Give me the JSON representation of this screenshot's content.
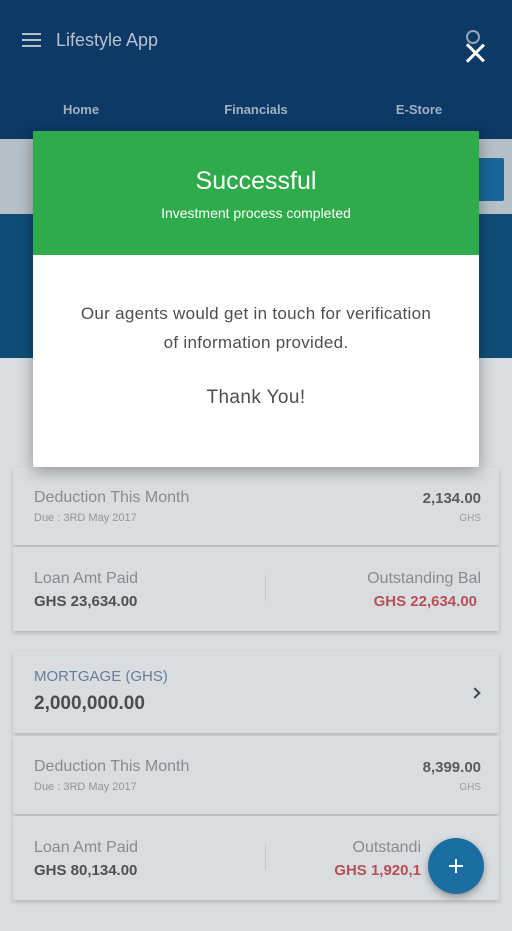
{
  "app": {
    "title": "Lifestyle App",
    "tabs": [
      "Home",
      "Financials",
      "E-Store"
    ]
  },
  "loan": {
    "deduction_label": "Deduction This Month",
    "due": "Due : 3RD May 2017",
    "deduction_value": "2,134.00",
    "currency": "GHS",
    "paid_label": "Loan Amt Paid",
    "paid_value": "GHS 23,634.00",
    "balance_label": "Outstanding Bal",
    "balance_value": "GHS 22,634.00"
  },
  "mortgage": {
    "label": "MORTGAGE (GHS)",
    "amount": "2,000,000.00",
    "deduction_label": "Deduction This Month",
    "due": "Due : 3RD May 2017",
    "deduction_value": "8,399.00",
    "currency": "GHS",
    "paid_label": "Loan Amt Paid",
    "paid_value": "GHS 80,134.00",
    "balance_label": "Outstandi",
    "balance_value": "GHS 1,920,1"
  },
  "dialog": {
    "title": "Successful",
    "subtitle": "Investment process completed",
    "message": "Our agents would get in touch for verification of information provided.",
    "thanks": "Thank You!"
  },
  "colors": {
    "header": "#0d3d6d",
    "success": "#2eab4a",
    "accent": "#1b6ea2",
    "balance": "#c3545b"
  },
  "icons": [
    "menu-icon",
    "search-icon",
    "close-icon",
    "chevron-right-icon",
    "add-icon"
  ]
}
